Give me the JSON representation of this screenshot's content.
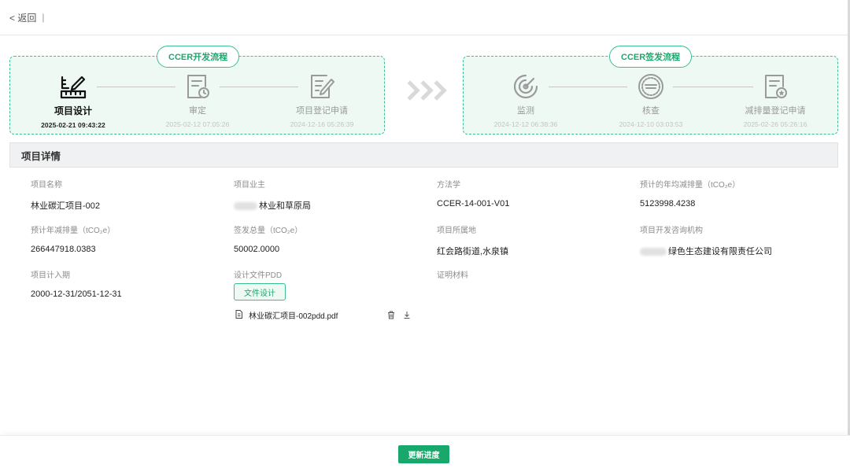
{
  "header": {
    "back_label": "< 返回",
    "separator": "|"
  },
  "dev_flow": {
    "title": "CCER开发流程",
    "steps": [
      {
        "name": "项目设计",
        "time": "2025-02-21 09:43:22",
        "icon": "design-ruler-icon",
        "active": true
      },
      {
        "name": "审定",
        "time": "2025-02-12 07:05:26",
        "icon": "document-clock-icon",
        "active": false
      },
      {
        "name": "项目登记申请",
        "time": "2024-12-16 05:26:39",
        "icon": "document-edit-icon",
        "active": false
      }
    ]
  },
  "issue_flow": {
    "title": "CCER签发流程",
    "steps": [
      {
        "name": "监测",
        "time": "2024-12-12 06:38:36",
        "icon": "monitor-target-icon",
        "active": false
      },
      {
        "name": "核查",
        "time": "2024-12-10 03:03:53",
        "icon": "verify-seal-icon",
        "active": false
      },
      {
        "name": "减排量登记申请",
        "time": "2025-02-26 05:26:16",
        "icon": "document-star-icon",
        "active": false
      }
    ]
  },
  "details": {
    "title": "项目详情",
    "project_name": {
      "label": "项目名称",
      "value": "林业碳汇项目-002"
    },
    "project_owner": {
      "label": "项目业主",
      "value": "林业和草原局"
    },
    "methodology": {
      "label": "方法学",
      "value": "CCER-14-001-V01"
    },
    "annual_reduction": {
      "label": "预计的年均减排量（tCO₂e）",
      "value": "5123998.4238"
    },
    "total_reduction": {
      "label": "预计年减排量（tCO₂e）",
      "value": "266447918.0383"
    },
    "issued_total": {
      "label": "签发总量（tCO₂e）",
      "value": "50002.0000"
    },
    "location": {
      "label": "项目所属地",
      "value": "红会路街道,水泉镇"
    },
    "consultant": {
      "label": "项目开发咨询机构",
      "value": "绿色生态建设有限责任公司"
    },
    "period": {
      "label": "项目计入期",
      "value": "2000-12-31/2051-12-31"
    },
    "pdd": {
      "label": "设计文件PDD",
      "button": "文件设计",
      "file_name": "林业碳汇项目-002pdd.pdf"
    },
    "proof": {
      "label": "证明材料"
    }
  },
  "footer": {
    "update_button": "更新进度"
  },
  "colors": {
    "accent": "#18a86b",
    "flow_bg": "#eef9f4",
    "flow_border": "#3cbf8e"
  }
}
